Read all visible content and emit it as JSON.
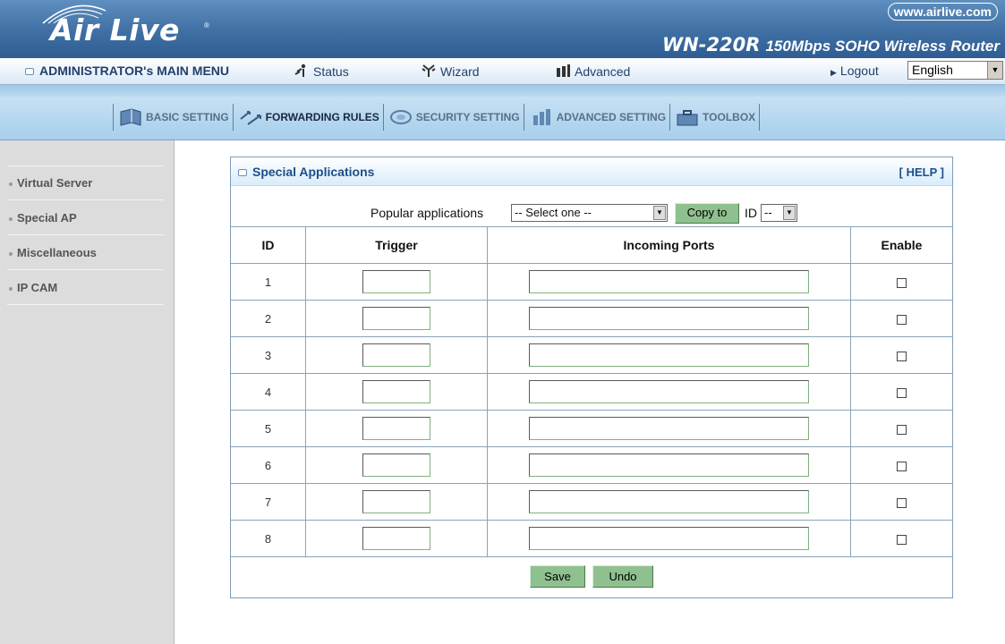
{
  "header": {
    "brand": "Air Live",
    "url": "www.airlive.com",
    "model": "WN-220R",
    "model_desc": "150Mbps SOHO Wireless Router"
  },
  "menubar": {
    "main_menu": "ADMINISTRATOR's MAIN MENU",
    "status": "Status",
    "wizard": "Wizard",
    "advanced": "Advanced",
    "logout": "Logout",
    "language": "English"
  },
  "subnav": {
    "tabs": [
      {
        "label": "BASIC SETTING",
        "icon": "notebook-icon"
      },
      {
        "label": "FORWARDING RULES",
        "icon": "arrows-icon"
      },
      {
        "label": "SECURITY SETTING",
        "icon": "security-icon"
      },
      {
        "label": "ADVANCED SETTING",
        "icon": "advanced-icon"
      },
      {
        "label": "TOOLBOX",
        "icon": "toolbox-icon"
      }
    ]
  },
  "sidebar": {
    "items": [
      "Virtual Server",
      "Special AP",
      "Miscellaneous",
      "IP CAM"
    ]
  },
  "panel": {
    "title": "Special Applications",
    "help": "[ HELP ]",
    "popular_label": "Popular applications",
    "popular_selected": "-- Select one --",
    "copy_to": "Copy to",
    "id_label": "ID",
    "id_selected": "--",
    "columns": [
      "ID",
      "Trigger",
      "Incoming Ports",
      "Enable"
    ],
    "rows": [
      "1",
      "2",
      "3",
      "4",
      "5",
      "6",
      "7",
      "8"
    ],
    "save": "Save",
    "undo": "Undo"
  }
}
